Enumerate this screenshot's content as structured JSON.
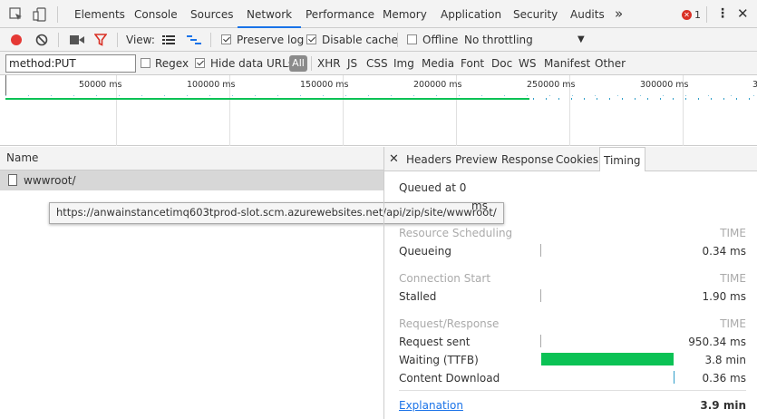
{
  "tabs": [
    "Elements",
    "Console",
    "Sources",
    "Network",
    "Performance",
    "Memory",
    "Application",
    "Security",
    "Audits"
  ],
  "active_tab": "Network",
  "more_tabs": "»",
  "error_count": "1",
  "toolbar": {
    "view_label": "View:",
    "preserve_log": "Preserve log",
    "disable_cache": "Disable cache",
    "offline": "Offline",
    "throttling": "No throttling"
  },
  "filter": {
    "value": "method:PUT",
    "regex": "Regex",
    "hide_data_urls": "Hide data URLs",
    "all": "All",
    "types": [
      "XHR",
      "JS",
      "CSS",
      "Img",
      "Media",
      "Font",
      "Doc",
      "WS",
      "Manifest",
      "Other"
    ]
  },
  "overview_ticks": [
    "50000 ms",
    "100000 ms",
    "150000 ms",
    "200000 ms",
    "250000 ms",
    "300000 ms",
    "3"
  ],
  "name_header": "Name",
  "request": {
    "name": "wwwroot/",
    "url": "https://anwainstancetimq603tprod-slot.scm.azurewebsites.net/api/zip/site/wwwroot/"
  },
  "detail_tabs": [
    "Headers",
    "Preview",
    "Response",
    "Cookies",
    "Timing"
  ],
  "active_detail_tab": "Timing",
  "timing": {
    "queued": "Queued at 0",
    "started_suffix": "ms",
    "time_header": "TIME",
    "sections": [
      {
        "title": "Resource Scheduling",
        "rows": [
          {
            "label": "Queueing",
            "value": "0.34 ms"
          }
        ]
      },
      {
        "title": "Connection Start",
        "rows": [
          {
            "label": "Stalled",
            "value": "1.90 ms"
          }
        ]
      },
      {
        "title": "Request/Response",
        "rows": [
          {
            "label": "Request sent",
            "value": "950.34 ms"
          },
          {
            "label": "Waiting (TTFB)",
            "value": "3.8 min"
          },
          {
            "label": "Content Download",
            "value": "0.36 ms"
          }
        ]
      }
    ],
    "explanation": "Explanation",
    "total": "3.9 min"
  },
  "colors": {
    "record": "#e53935",
    "filter": "#d93025",
    "ttfb": "#0bc255",
    "download": "#2f9ec9",
    "accent": "#1a73e8",
    "overview_line": "#0bc255",
    "error": "#d93025"
  }
}
